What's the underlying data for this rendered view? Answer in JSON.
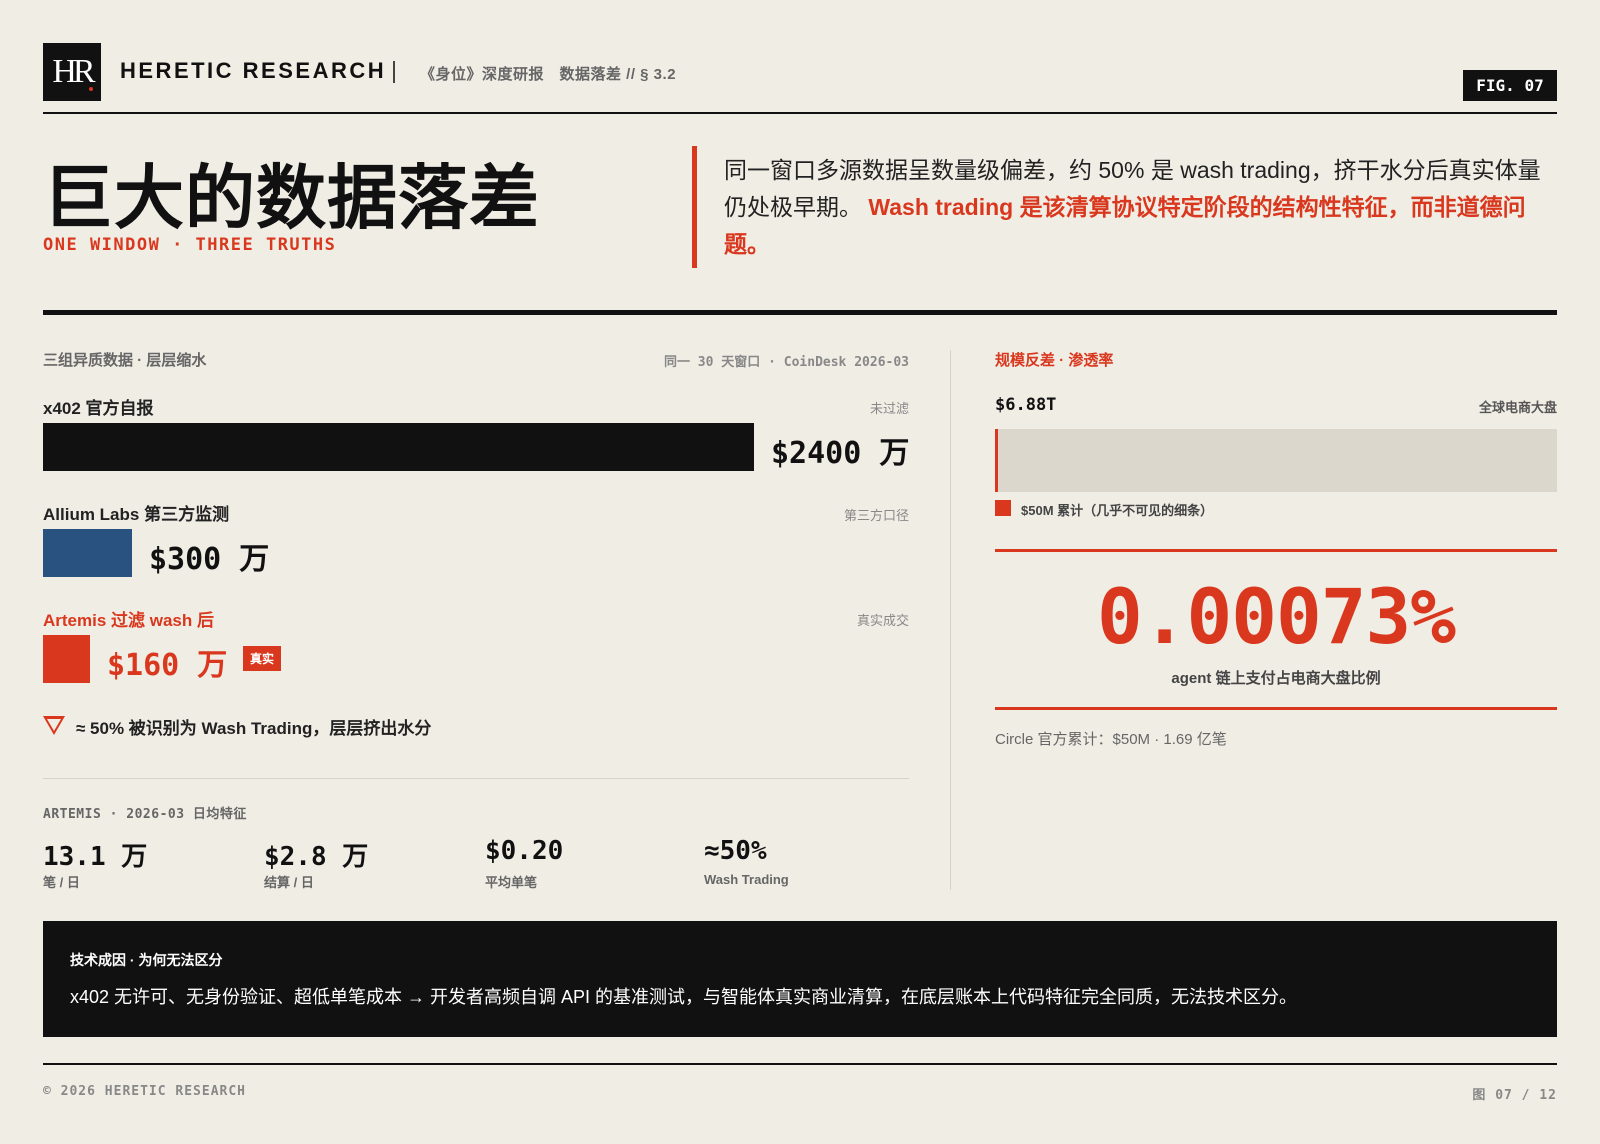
{
  "header": {
    "logo_text": "HR",
    "brand": "HERETIC RESEARCH",
    "crumb": "《身位》深度研报　数据落差 // § 3.2",
    "fig_label": "FIG. 07"
  },
  "hero": {
    "title": "巨大的数据落差",
    "subtitle": "ONE WINDOW · THREE TRUTHS",
    "lead_plain": "同一窗口多源数据呈数量级偏差，约 50% 是 wash trading，挤干水分后真实体量仍处极早期。",
    "lead_accent": "Wash trading 是该清算协议特定阶段的结构性特征，而非道德问题。"
  },
  "left": {
    "section_label": "三组异质数据 · 层层缩水",
    "source_label": "同一 30 天窗口 · CoinDesk 2026-03",
    "bars": [
      {
        "label": "x402 官方自报",
        "tag": "未过滤",
        "value": 2400,
        "display": "$2400 万",
        "color": "#111111"
      },
      {
        "label": "Allium Labs 第三方监测",
        "tag": "第三方口径",
        "value": 300,
        "display": "$300 万",
        "color": "#2a5280"
      },
      {
        "label": "Artemis 过滤 wash 后",
        "tag": "真实成交",
        "value": 160,
        "display": "$160 万",
        "color": "#d9381e",
        "badge": "真实"
      }
    ],
    "note": "≈ 50% 被识别为 Wash Trading，层层挤出水分",
    "stats_header": "ARTEMIS · 2026-03 日均特征",
    "stats": [
      {
        "value": "13.1 万",
        "label": "笔 / 日"
      },
      {
        "value": "$2.8 万",
        "label": "结算 / 日"
      },
      {
        "value": "$0.20",
        "label": "平均单笔"
      },
      {
        "value": "≈50%",
        "label": "Wash Trading"
      }
    ]
  },
  "right": {
    "section_label": "规模反差 · 渗透率",
    "top_value": "$6.88T",
    "top_tag": "全球电商大盘",
    "legend": "$50M 累计（几乎不可见的细条）",
    "share_percent": 0.00073,
    "big_number": "0.00073%",
    "big_label": "agent 链上支付占电商大盘比例",
    "circle_note": "Circle 官方累计：$50M · 1.69 亿笔"
  },
  "callout": {
    "label": "技术成因 · 为何无法区分",
    "text": "x402 无许可、无身份验证、超低单笔成本 → 开发者高频自调 API 的基准测试，与智能体真实商业清算，在底层账本上代码特征完全同质，无法技术区分。"
  },
  "footer": {
    "left": "© 2026 HERETIC RESEARCH",
    "right": "图 07 / 12"
  },
  "colors": {
    "accent": "#d9381e",
    "ink": "#111111",
    "blue": "#2a5280",
    "paper": "#f0ede5"
  }
}
